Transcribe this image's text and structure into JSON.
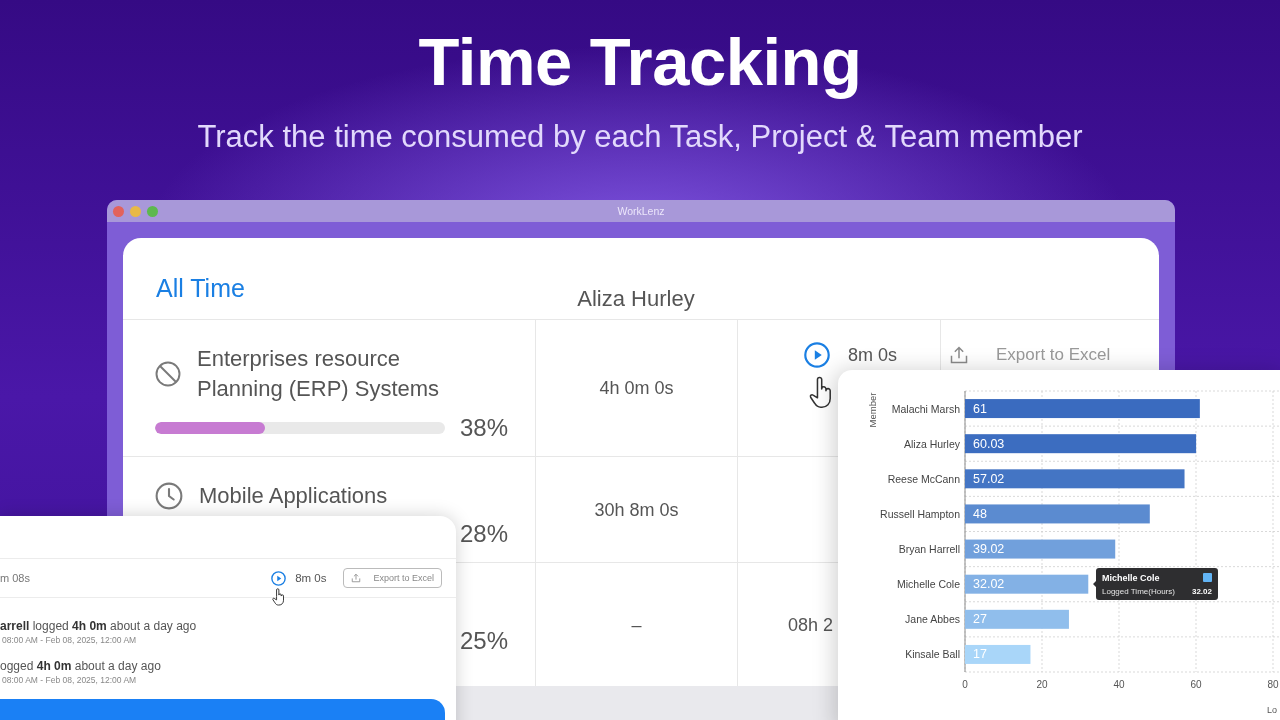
{
  "hero": {
    "title": "Time Tracking",
    "subtitle": "Track the time consumed by each Task, Project & Team member"
  },
  "window": {
    "title": "WorkLenz"
  },
  "report": {
    "period": "All Time",
    "member": "Aliza Hurley",
    "rows": [
      {
        "kind": "blocked",
        "name": "Enterprises resource Planning (ERP) Systems",
        "level": 0.38,
        "percent": "38%",
        "logged": "4h 0m 0s",
        "timer": {
          "play_button": true,
          "hovered": true,
          "text": "8m 0s"
        },
        "export": "Export to Excel"
      },
      {
        "kind": "clock",
        "name": "Mobile Applications",
        "percent": "28%",
        "logged": "30h 8m 0s"
      },
      {
        "percent": "25%",
        "logged": "–",
        "timer": {
          "text": "08h 2"
        }
      }
    ]
  },
  "detail_panel": {
    "duration": "m 08s",
    "timer": {
      "hovered": true,
      "text": "8m 0s"
    },
    "export": "Export to Excel",
    "logs": [
      {
        "text": "**arrell** logged **4h 0m** about a day ago",
        "range": "08:00 AM - Feb 08, 2025, 12:00 AM"
      },
      {
        "text": "ogged **4h 0m** about a day ago",
        "range": "08:00 AM - Feb 08, 2025, 12:00 AM"
      }
    ]
  },
  "chart_panel": {
    "chart_data": {
      "type": "bar",
      "orientation": "horizontal",
      "ylabel": "Member",
      "xlabel": "Lo",
      "categories": [
        "Malachi Marsh",
        "Aliza Hurley",
        "Reese McCann",
        "Russell Hampton",
        "Bryan Harrell",
        "Michelle Cole",
        "Jane Abbes",
        "Kinsale Ball"
      ],
      "series": [
        {
          "name": "Logged Time(Hours)",
          "values": [
            61,
            60.03,
            57.02,
            48,
            39.02,
            32.02,
            27,
            17
          ]
        }
      ],
      "xlim": [
        0,
        80
      ],
      "xticks": [
        0,
        20,
        40,
        60,
        80
      ],
      "grid": true,
      "data_labels": true
    },
    "tooltip": {
      "title": "Michelle Cole",
      "value": "32.02",
      "color": "#62b4f4"
    }
  }
}
